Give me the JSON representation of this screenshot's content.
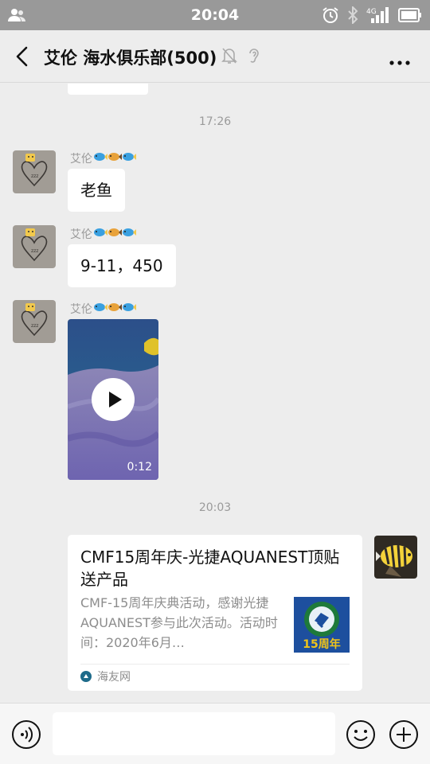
{
  "status_bar": {
    "time": "20:04",
    "icons": [
      "contacts-icon",
      "alarm-icon",
      "bluetooth-icon",
      "signal-4g-icon",
      "battery-icon"
    ],
    "network": "4G"
  },
  "header": {
    "title": "艾伦 海水俱乐部(500)",
    "icons": [
      "back-icon",
      "mute-bell-icon",
      "earpiece-icon",
      "more-icon"
    ]
  },
  "messages": {
    "timestamp_1": "17:26",
    "sender_name": "艾伦",
    "sender_emojis": [
      "fish-icon",
      "tropical-fish-icon",
      "fish-icon"
    ],
    "text_1": "老鱼",
    "text_2": "9-11，450",
    "video_duration": "0:12",
    "timestamp_2": "20:03",
    "card": {
      "title": "CMF15周年庆-光捷AQUANEST顶贴送产品",
      "description": "CMF-15周年庆典活动，感谢光捷AQUANEST参与此次活动。活动时间：2020年6月…",
      "thumb_text": "15周年",
      "source": "海友网"
    }
  },
  "input_bar": {
    "text_value": "",
    "icons": [
      "voice-icon",
      "emoji-icon",
      "plus-icon"
    ]
  },
  "colors": {
    "status_bar": "#999999",
    "chat_background": "#ededed",
    "bubble": "#ffffff",
    "timestamp_text": "#9a9a9a"
  }
}
